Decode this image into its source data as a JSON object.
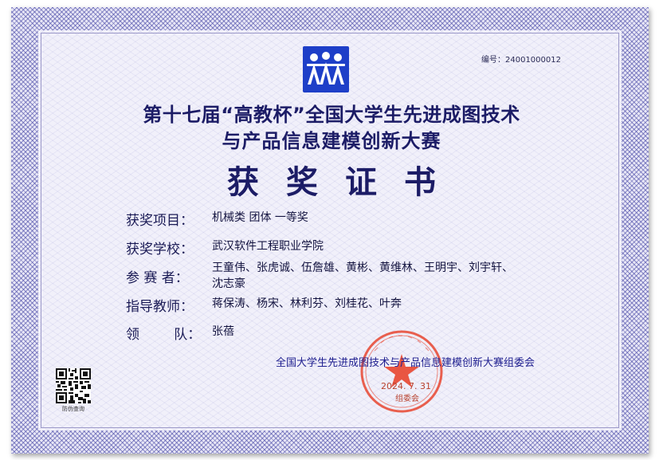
{
  "certificate": {
    "number": "编号：24001000012",
    "title_line1": "第十七届“高教杯”全国大学生先进成图技术",
    "title_line2": "与产品信息建模创新大赛",
    "award_title": "获奖证书",
    "fields": [
      {
        "label": "获奖项目：",
        "value": "机械类  团体  一等奖"
      },
      {
        "label": "获奖学校：",
        "value": "武汉软件工程职业学院"
      },
      {
        "label": "参  赛  者：",
        "value": "王童伟、张虎诚、伍詹雄、黄彬、黄维林、王明宇、刘宇轩、",
        "value2": "沈志豪"
      },
      {
        "label": "指导教师：",
        "value": "蒋保涛、杨宋、林利芬、刘桂花、叶奔"
      },
      {
        "label": "领        队：",
        "value": "张蓓"
      }
    ],
    "issuer": "全国大学生先进成图技术与产品信息建模创新大赛组委会",
    "seal_date": "2024. 7. 31",
    "seal_sub": "组委会",
    "qr_label": "防伪查询"
  },
  "colors": {
    "title_navy": "#1c1c66",
    "seal_red": "#e8452f",
    "logo_blue": "#1e3fc8"
  },
  "icons": {
    "logo": "three-figures-logo-icon",
    "qr": "qr-code-icon",
    "seal": "red-star-seal-icon"
  }
}
